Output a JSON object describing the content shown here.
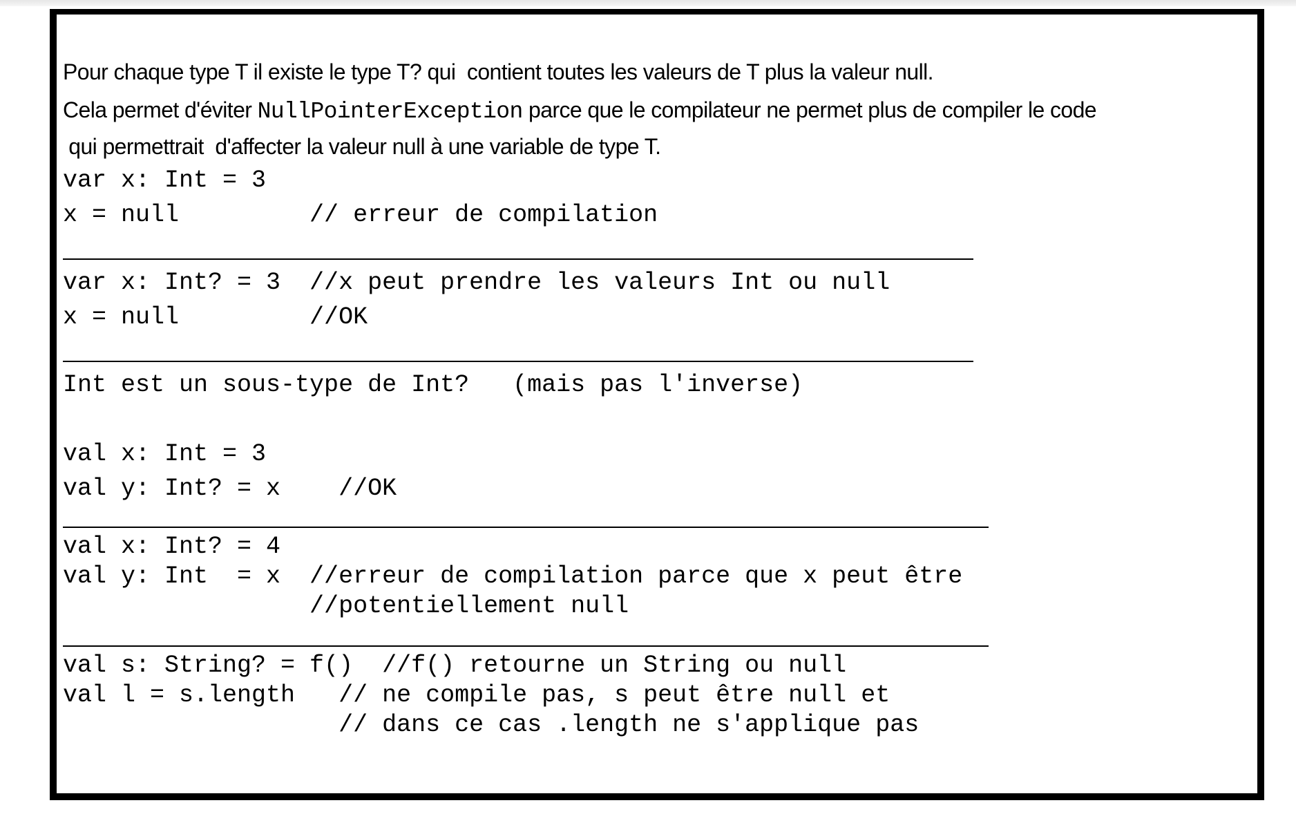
{
  "intro": {
    "line1": "Pour chaque type T il existe le type T? qui  contient toutes les valeurs de T plus la valeur null.",
    "line2_before": "Cela permet d'éviter ",
    "line2_code": "NullPointerException",
    "line2_after": " parce que le compilateur ne permet plus de compiler le code",
    "line3": " qui permettrait  d'affecter la valeur null à une variable de type T."
  },
  "code": [
    "var x: Int = 3",
    "x = null         // erreur de compilation",
    "var x: Int? = 3  //x peut prendre les valeurs Int ou null",
    "x = null         //OK",
    "Int est un sous-type de Int?   (mais pas l'inverse)",
    "val x: Int = 3",
    "val y: Int? = x    //OK",
    "val x: Int? = 4",
    "val y: Int  = x  //erreur de compilation parce que x peut être",
    "                 //potentiellement null",
    "val s: String? = f()  //f() retourne un String ou null",
    "val l = s.length   // ne compile pas, s peut être null et",
    "                   // dans ce cas .length ne s'applique pas"
  ]
}
